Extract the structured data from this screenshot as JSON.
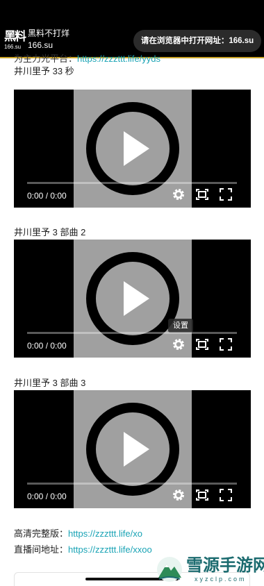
{
  "header": {
    "logo_glyph": "黑料",
    "logo_sub": "166.su",
    "site_title": "黑料不打烊",
    "site_domain": "166.su",
    "open_browser_label": "请在浏览器中打开网址：166.su"
  },
  "partial_line": {
    "text": "为主力光平台：",
    "link": "https://zzzttt.life/yyds"
  },
  "videos": [
    {
      "title": "井川里予 33 秒",
      "time": "0:00 / 0:00"
    },
    {
      "title": "井川里予 3 部曲 2",
      "time": "0:00 / 0:00",
      "tooltip": "设置"
    },
    {
      "title": "井川里予 3 部曲 3",
      "time": "0:00 / 0:00"
    }
  ],
  "links": [
    {
      "label": "高清完整版：",
      "url": "https://zzzttt.life/xo"
    },
    {
      "label": "直播间地址：",
      "url": "https://zzzttt.life/xxoo"
    }
  ],
  "watermark": {
    "name": "雪源手游网",
    "url": "xyzclp.com"
  },
  "colors": {
    "link": "#19a3b5",
    "gold_strip": "#c9a227",
    "poster_gray": "#a0a0a0",
    "watermark": "#1b6b6f"
  },
  "icons": [
    "play-icon",
    "settings-gear-icon",
    "theater-mode-icon",
    "fullscreen-icon"
  ]
}
